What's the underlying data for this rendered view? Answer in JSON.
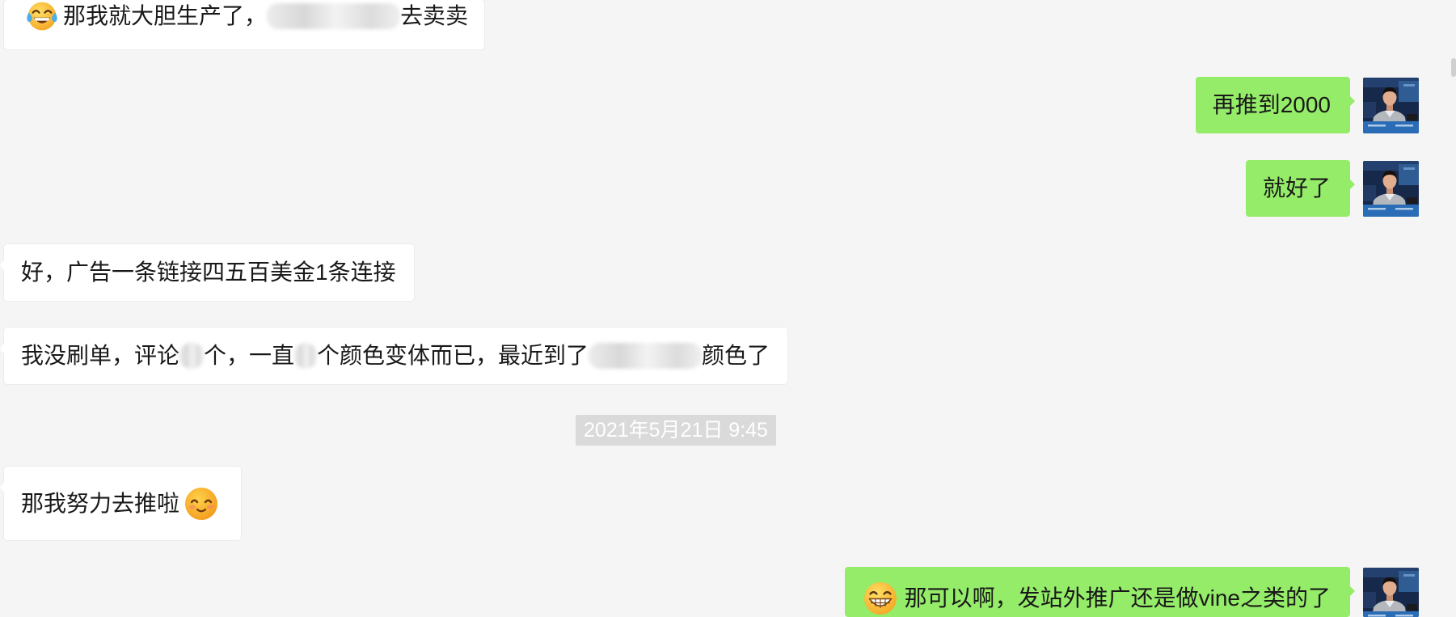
{
  "colors": {
    "chat_background": "#f5f5f5",
    "sent_bubble": "#95ec69",
    "received_bubble": "#ffffff",
    "message_text": "#191919",
    "timestamp_background": "#dadada",
    "timestamp_text": "#ffffff"
  },
  "messages": [
    {
      "emoji_icon": "face-with-tears-of-joy-icon",
      "text": "那我就大胆生产了，",
      "text_after": "去卖卖"
    },
    {
      "text": "再推到2000"
    },
    {
      "text": "就好了"
    },
    {
      "text": "好，广告一条链接四五百美金1条连接"
    },
    {
      "parts": [
        "我没刷单，评论",
        "个，一直",
        "个颜色变体而已，最近到了",
        "颜色了"
      ]
    },
    {
      "text": "那我努力去推啦",
      "emoji_icon": "smiling-face-with-closed-eyes-icon"
    },
    {
      "emoji_icon": "grinning-face-icon",
      "text": "那可以啊，发站外推广还是做vine之类的了"
    }
  ],
  "timestamp": "2021年5月21日 9:45"
}
